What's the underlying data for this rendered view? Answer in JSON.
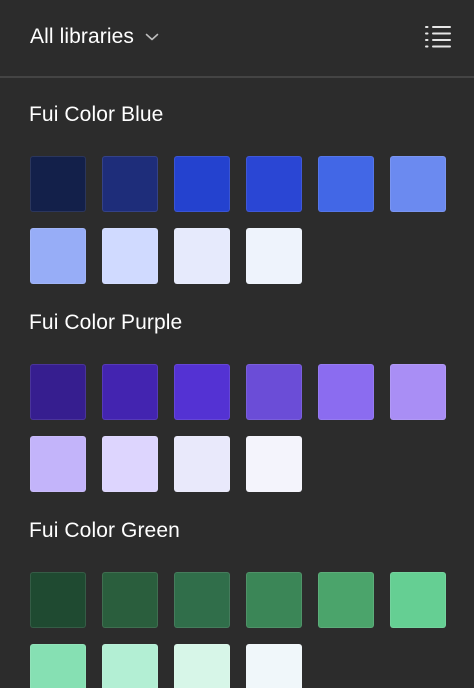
{
  "header": {
    "library_label": "All libraries",
    "chevron_icon": "chevron-down-icon",
    "list_icon": "list-view-icon"
  },
  "sections": [
    {
      "title": "Fui Color Blue",
      "colors": [
        "#13204a",
        "#1e2d7a",
        "#2442cf",
        "#2a46d4",
        "#4267e6",
        "#6b8af0",
        "#97adf7",
        "#d0daff",
        "#e6eafc",
        "#eef3fc"
      ]
    },
    {
      "title": "Fui Color Purple",
      "colors": [
        "#361e8f",
        "#4324b0",
        "#5432d3",
        "#6b4dd7",
        "#8b6cf0",
        "#a98ef5",
        "#c3b4fa",
        "#ddd5fe",
        "#e9e9fb",
        "#f4f4fc"
      ]
    },
    {
      "title": "Fui Color Green",
      "colors": [
        "#1f4a31",
        "#2a5e3d",
        "#306e4a",
        "#3b8657",
        "#4ba46b",
        "#65cf93",
        "#86e0b3",
        "#b3efd4",
        "#d7f6e8",
        "#f0f7fa"
      ]
    }
  ]
}
